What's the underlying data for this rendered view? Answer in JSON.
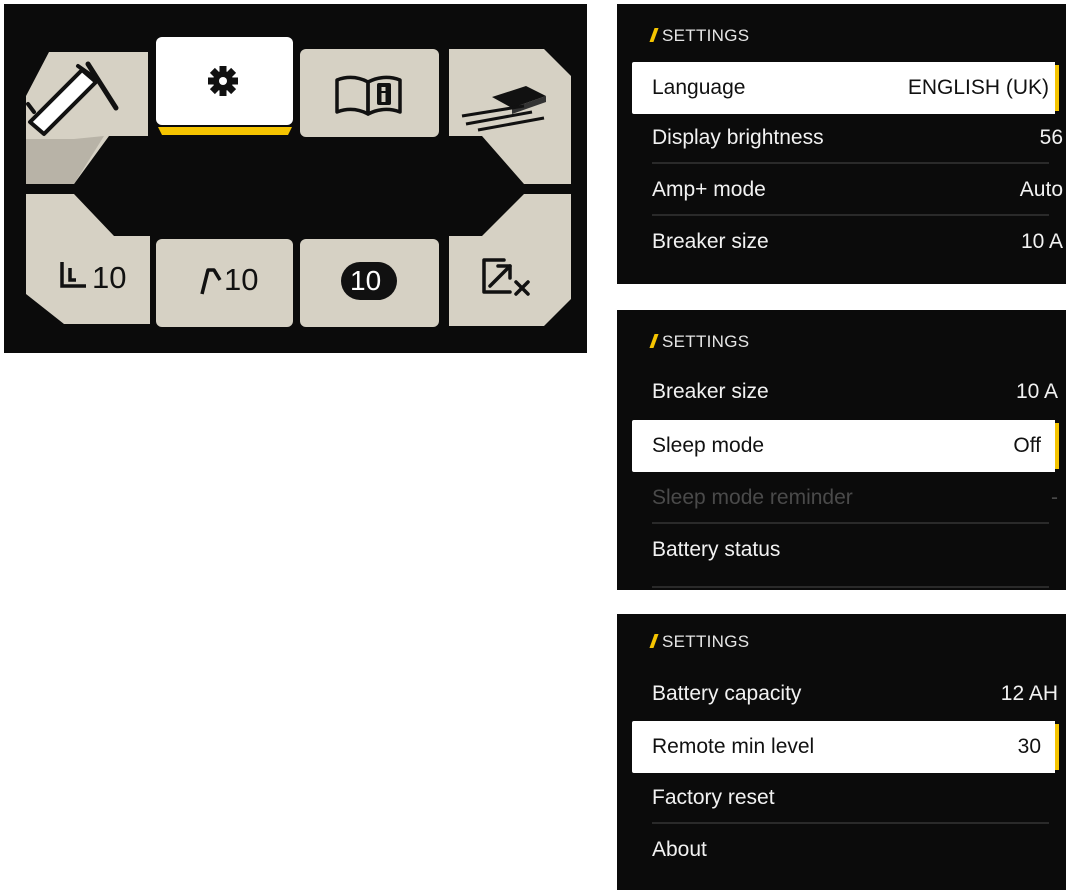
{
  "home_menu": {
    "tiles": [
      {
        "id": "torch",
        "icon": "welding-torch-icon"
      },
      {
        "id": "settings",
        "icon": "gear-icon",
        "selected": true
      },
      {
        "id": "manual",
        "icon": "book-info-icon"
      },
      {
        "id": "wire",
        "icon": "wire-feed-icon"
      },
      {
        "id": "param-1",
        "icon": "start-profile-icon",
        "text": "10"
      },
      {
        "id": "param-2",
        "icon": "end-profile-icon",
        "text": "10"
      },
      {
        "id": "memory",
        "icon": "memory-channel-badge-icon",
        "text": "10"
      },
      {
        "id": "exit",
        "icon": "exit-arrow-icon"
      }
    ],
    "accent_color": "#f5c400"
  },
  "settings_panels": [
    {
      "header": "SETTINGS",
      "rows": [
        {
          "label": "Language",
          "value": "ENGLISH (UK)",
          "state": "selected"
        },
        {
          "label": "Display brightness",
          "value": "56",
          "state": "normal"
        },
        {
          "label": "Amp+ mode",
          "value": "Auto",
          "state": "normal"
        },
        {
          "label": "Breaker size",
          "value": "10 A",
          "state": "normal"
        }
      ]
    },
    {
      "header": "SETTINGS",
      "rows": [
        {
          "label": "Breaker size",
          "value": "10 A",
          "state": "normal"
        },
        {
          "label": "Sleep mode",
          "value": "Off",
          "state": "selected"
        },
        {
          "label": "Sleep mode reminder",
          "value": "-",
          "state": "disabled"
        },
        {
          "label": "Battery status",
          "value": "",
          "state": "normal"
        }
      ]
    },
    {
      "header": "SETTINGS",
      "rows": [
        {
          "label": "Battery capacity",
          "value": "12 AH",
          "state": "normal"
        },
        {
          "label": "Remote min level",
          "value": "30",
          "state": "selected"
        },
        {
          "label": "Factory reset",
          "value": "",
          "state": "normal"
        },
        {
          "label": "About",
          "value": "",
          "state": "normal"
        }
      ]
    }
  ]
}
